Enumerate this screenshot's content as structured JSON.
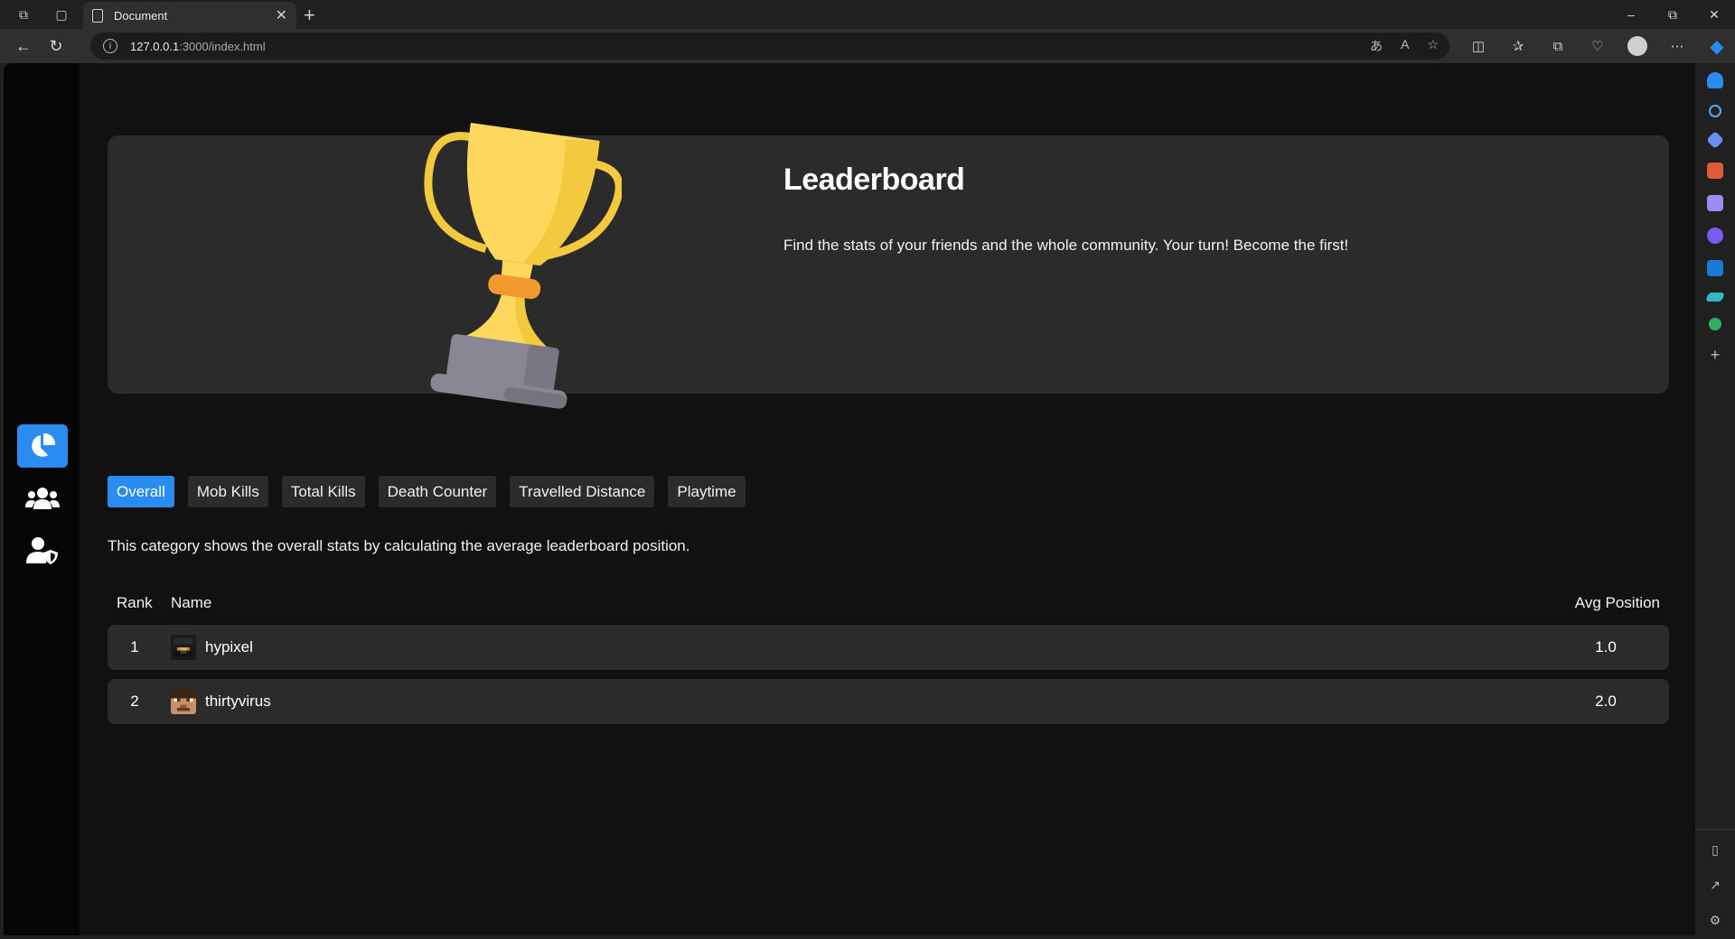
{
  "browser": {
    "tab_title": "Document",
    "url_host": "127.0.0.1",
    "url_rest": ":3000/index.html"
  },
  "hero": {
    "title": "Leaderboard",
    "subtitle": "Find the stats of your friends and the whole community. Your turn! Become the first!"
  },
  "sidebar": {
    "items": [
      {
        "icon": "pie-chart-icon",
        "active": true
      },
      {
        "icon": "users-icon",
        "active": false
      },
      {
        "icon": "user-shield-icon",
        "active": false
      }
    ]
  },
  "categories": [
    {
      "label": "Overall",
      "active": true
    },
    {
      "label": "Mob Kills",
      "active": false
    },
    {
      "label": "Total Kills",
      "active": false
    },
    {
      "label": "Death Counter",
      "active": false
    },
    {
      "label": "Travelled Distance",
      "active": false
    },
    {
      "label": "Playtime",
      "active": false
    }
  ],
  "category_description": "This category shows the overall stats by calculating the average leaderboard position.",
  "table": {
    "headers": {
      "rank": "Rank",
      "name": "Name",
      "avg": "Avg Position"
    },
    "rows": [
      {
        "rank": "1",
        "name": "hypixel",
        "avg": "1.0"
      },
      {
        "rank": "2",
        "name": "thirtyvirus",
        "avg": "2.0"
      }
    ]
  },
  "colors": {
    "accent": "#2a8cf0",
    "panel": "#2b2b2b",
    "page_bg": "#111111",
    "trophy_gold": "#fcd34d"
  }
}
